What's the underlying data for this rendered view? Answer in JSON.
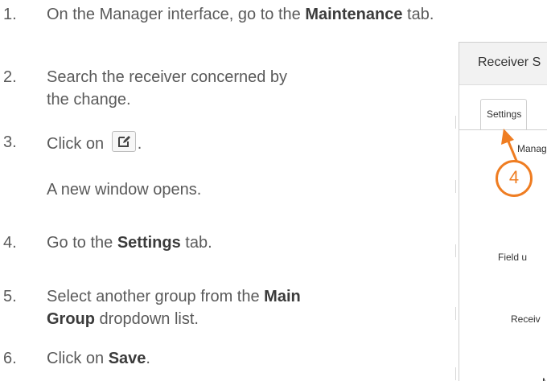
{
  "steps": [
    {
      "num": "1.",
      "pre": "On the Manager interface, go to the ",
      "bold": "Maintenance",
      "post": " tab."
    },
    {
      "num": "2.",
      "text": "Search the receiver concerned by the change."
    },
    {
      "num": "3.",
      "pre": "Click on ",
      "post": ".",
      "note": "A new window opens."
    },
    {
      "num": "4.",
      "pre": "Go to the ",
      "bold": "Settings",
      "post": " tab."
    },
    {
      "num": "5.",
      "pre": "Select another group from the ",
      "bold": "Main Group",
      "post": " dropdown list."
    },
    {
      "num": "6.",
      "pre": "Click on ",
      "bold": "Save",
      "post": "."
    }
  ],
  "screenshot": {
    "title": "Receiver S",
    "tab_label": "Settings",
    "label_manager": "Manag",
    "label_field": "Field u",
    "label_receiver": "Receiv",
    "label_m": "M"
  },
  "callout": {
    "number": "4",
    "color": "#ef7d22"
  },
  "icons": {
    "edit": "edit-icon"
  }
}
